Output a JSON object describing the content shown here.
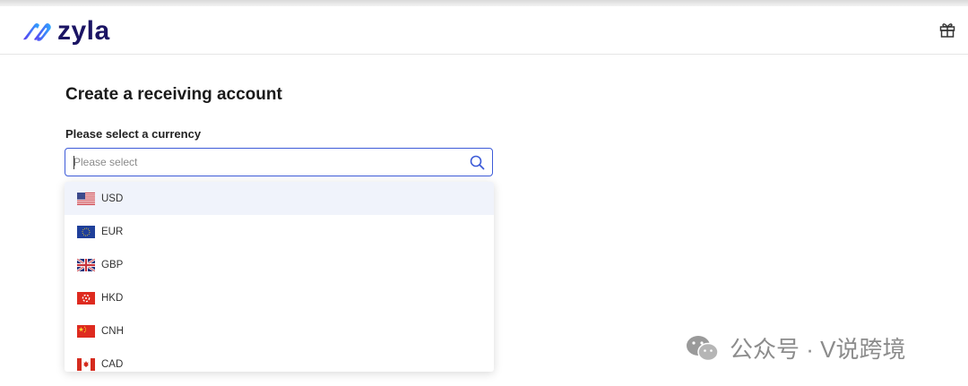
{
  "header": {
    "brand": "zyla",
    "gift_icon": "gift-icon"
  },
  "page": {
    "title": "Create a receiving account",
    "currency_label": "Please select a currency",
    "search_placeholder": "Please select",
    "search_value": ""
  },
  "currencies": [
    {
      "code": "USD",
      "flag": "us-flag-icon",
      "highlighted": true
    },
    {
      "code": "EUR",
      "flag": "eu-flag-icon",
      "highlighted": false
    },
    {
      "code": "GBP",
      "flag": "uk-flag-icon",
      "highlighted": false
    },
    {
      "code": "HKD",
      "flag": "hk-flag-icon",
      "highlighted": false
    },
    {
      "code": "CNH",
      "flag": "cn-flag-icon",
      "highlighted": false
    },
    {
      "code": "CAD",
      "flag": "ca-flag-icon",
      "highlighted": false
    }
  ],
  "watermark": {
    "text": "公众号 · V说跨境"
  },
  "colors": {
    "brand": "#1b1464",
    "accent": "#3d5bd8",
    "highlight": "#f0f3fb"
  }
}
